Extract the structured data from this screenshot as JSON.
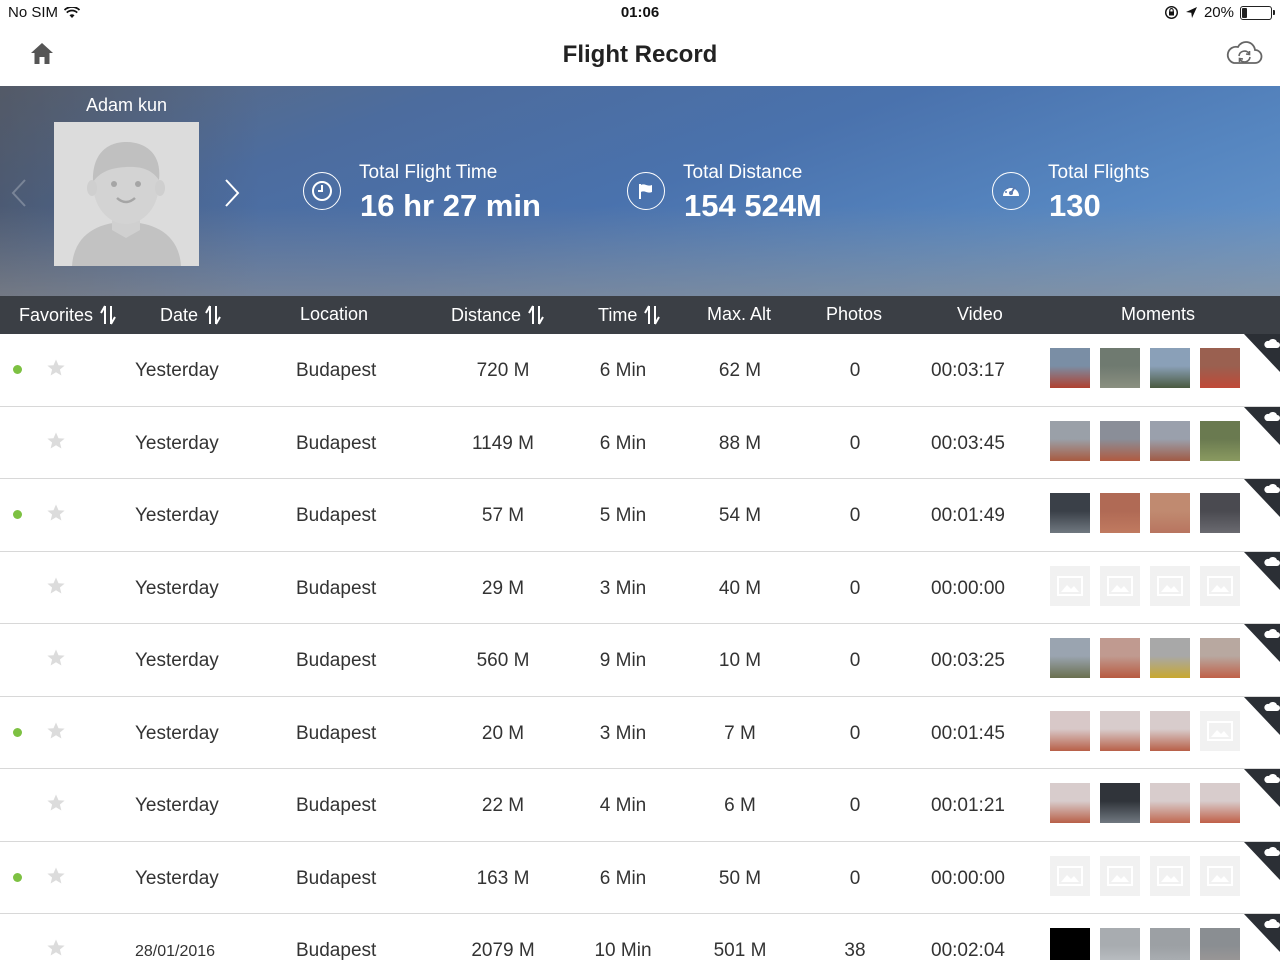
{
  "status_bar": {
    "carrier": "No SIM",
    "time": "01:06",
    "battery": "20%",
    "battery_level": 0.2
  },
  "nav": {
    "title": "Flight Record"
  },
  "profile": {
    "name": "Adam kun"
  },
  "stats": [
    {
      "label": "Total Flight Time",
      "value": "16 hr 27 min",
      "icon": "clock-icon"
    },
    {
      "label": "Total Distance",
      "value": "154 524M",
      "icon": "flag-icon"
    },
    {
      "label": "Total Flights",
      "value": "130",
      "icon": "speedometer-icon"
    }
  ],
  "columns": {
    "favorites": "Favorites",
    "date": "Date",
    "location": "Location",
    "distance": "Distance",
    "time": "Time",
    "max_alt": "Max. Alt",
    "photos": "Photos",
    "video": "Video",
    "moments": "Moments"
  },
  "colors": {
    "accent_dot": "#7dc142",
    "header_bg": "#3b3f45"
  },
  "rows": [
    {
      "synced": true,
      "date": "Yesterday",
      "location": "Budapest",
      "distance": "720 M",
      "time": "6 Min",
      "max_alt": "62 M",
      "photos": "0",
      "video": "00:03:17",
      "thumbs": [
        [
          "#7a8ea5",
          "#b04030"
        ],
        [
          "#6f7a70",
          "#8a8f80"
        ],
        [
          "#8aa0b8",
          "#4a5a40"
        ],
        [
          "#9a6050",
          "#c04a38"
        ]
      ]
    },
    {
      "synced": false,
      "date": "Yesterday",
      "location": "Budapest",
      "distance": "1149 M",
      "time": "6 Min",
      "max_alt": "88 M",
      "photos": "0",
      "video": "00:03:45",
      "thumbs": [
        [
          "#9aa0a8",
          "#a85a40"
        ],
        [
          "#8a8e98",
          "#b05a40"
        ],
        [
          "#9aa0ac",
          "#a05a45"
        ],
        [
          "#6a7a50",
          "#8a9a60"
        ]
      ]
    },
    {
      "synced": true,
      "date": "Yesterday",
      "location": "Budapest",
      "distance": "57 M",
      "time": "5 Min",
      "max_alt": "54 M",
      "photos": "0",
      "video": "00:01:49",
      "thumbs": [
        [
          "#3a4048",
          "#707880"
        ],
        [
          "#b06a55",
          "#c07a60"
        ],
        [
          "#c08a70",
          "#b87560"
        ],
        [
          "#4a4a50",
          "#6a6a70"
        ]
      ]
    },
    {
      "synced": false,
      "date": "Yesterday",
      "location": "Budapest",
      "distance": "29 M",
      "time": "3 Min",
      "max_alt": "40 M",
      "photos": "0",
      "video": "00:00:00",
      "thumbs": []
    },
    {
      "synced": false,
      "date": "Yesterday",
      "location": "Budapest",
      "distance": "560 M",
      "time": "9 Min",
      "max_alt": "10 M",
      "photos": "0",
      "video": "00:03:25",
      "thumbs": [
        [
          "#9aa4b0",
          "#6a7050"
        ],
        [
          "#c09a90",
          "#b85a40"
        ],
        [
          "#a8a8a8",
          "#c8a830"
        ],
        [
          "#b8a8a0",
          "#c06048"
        ]
      ]
    },
    {
      "synced": true,
      "date": "Yesterday",
      "location": "Budapest",
      "distance": "20 M",
      "time": "3 Min",
      "max_alt": "7 M",
      "photos": "0",
      "video": "00:01:45",
      "thumbs": [
        [
          "#d8c8c8",
          "#b86048"
        ],
        [
          "#d8cccc",
          "#b86048"
        ],
        [
          "#d8cccc",
          "#b86048"
        ]
      ]
    },
    {
      "synced": false,
      "date": "Yesterday",
      "location": "Budapest",
      "distance": "22 M",
      "time": "4 Min",
      "max_alt": "6 M",
      "photos": "0",
      "video": "00:01:21",
      "thumbs": [
        [
          "#d8cccc",
          "#b86048"
        ],
        [
          "#30343a",
          "#707880"
        ],
        [
          "#d8cccc",
          "#c06850"
        ],
        [
          "#d8cccc",
          "#c06048"
        ]
      ]
    },
    {
      "synced": true,
      "date": "Yesterday",
      "location": "Budapest",
      "distance": "163 M",
      "time": "6 Min",
      "max_alt": "50 M",
      "photos": "0",
      "video": "00:00:00",
      "thumbs": []
    },
    {
      "synced": false,
      "date": "28/01/2016",
      "location": "Budapest",
      "distance": "2079 M",
      "time": "10 Min",
      "max_alt": "501 M",
      "photos": "38",
      "video": "00:02:04",
      "thumbs": [
        [
          "#000000",
          "#000000"
        ],
        [
          "#a8acb0",
          "#c0c4c8"
        ],
        [
          "#9ca0a4",
          "#b0b4b8"
        ],
        [
          "#8a8e92",
          "#a09a98"
        ]
      ]
    }
  ]
}
